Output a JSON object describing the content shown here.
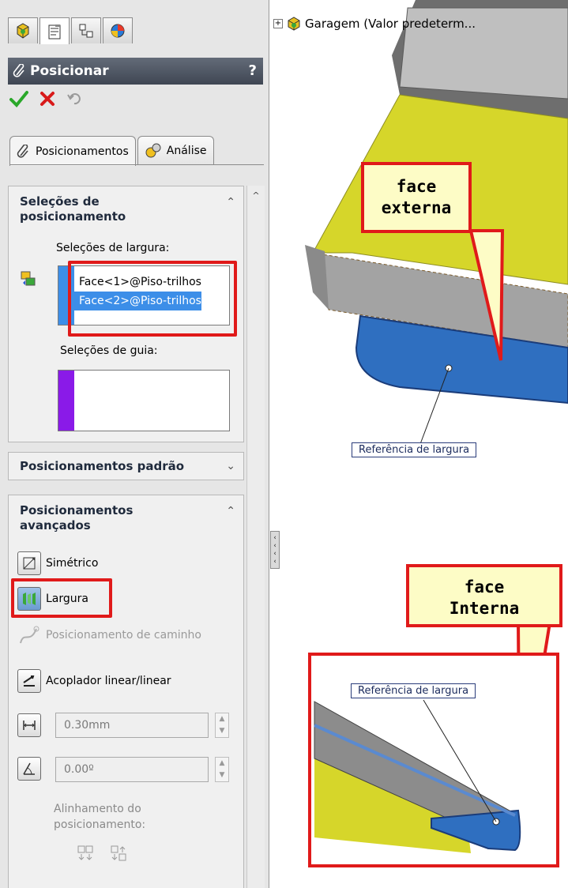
{
  "header": {
    "title": "Posicionar",
    "help": "?"
  },
  "tabs": [
    {
      "label": "Posicionamentos"
    },
    {
      "label": "Análise"
    }
  ],
  "mate_selections": {
    "title": "Seleções de posicionamento",
    "width_label": "Seleções de largura:",
    "width_items": [
      "Face<1>@Piso-trilhos",
      "Face<2>@Piso-trilhos"
    ],
    "guide_label": "Seleções de guia:"
  },
  "standard_mates": {
    "title": "Posicionamentos padrão"
  },
  "advanced_mates": {
    "title": "Posicionamentos avançados",
    "options": [
      {
        "label": "Simétrico",
        "icon": "symmetric-icon"
      },
      {
        "label": "Largura",
        "icon": "width-icon"
      },
      {
        "label": "Posicionamento de caminho",
        "icon": "path-mate-icon"
      },
      {
        "label": "Acoplador linear/linear",
        "icon": "linear-coupler-icon"
      }
    ],
    "distance_value": "0.30mm",
    "angle_value": "0.00º",
    "alignment_label": "Alinhamento do posicionamento:"
  },
  "tree": {
    "label": "Garagem  (Valor predeterm..."
  },
  "callouts": {
    "top": "face externa",
    "bottom": "face Interna"
  },
  "reference_labels": {
    "top": "Referência de largura",
    "bottom": "Referência de largura"
  },
  "colors": {
    "highlight": "#e01a1a",
    "selection": "#3c8ee8",
    "face_blue": "#2f6fc0",
    "floor_yellow": "#d6d62a"
  }
}
